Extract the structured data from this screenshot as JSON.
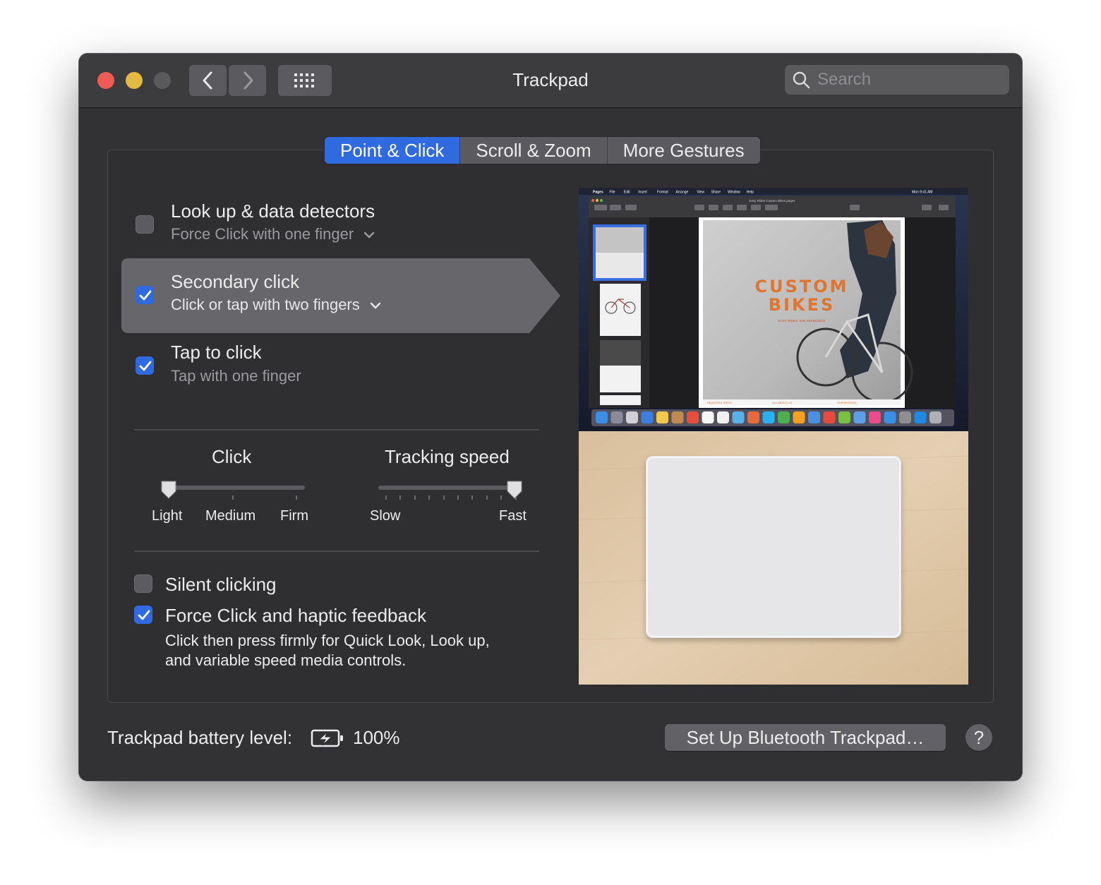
{
  "window": {
    "title": "Trackpad",
    "search_placeholder": "Search"
  },
  "tabs": [
    {
      "label": "Point & Click",
      "active": true
    },
    {
      "label": "Scroll & Zoom",
      "active": false
    },
    {
      "label": "More Gestures",
      "active": false
    }
  ],
  "options": [
    {
      "title": "Look up & data detectors",
      "subtitle": "Force Click with one finger",
      "checked": false,
      "has_dropdown": true
    },
    {
      "title": "Secondary click",
      "subtitle": "Click or tap with two fingers",
      "checked": true,
      "has_dropdown": true,
      "selected": true
    },
    {
      "title": "Tap to click",
      "subtitle": "Tap with one finger",
      "checked": true,
      "has_dropdown": false
    }
  ],
  "sliders": {
    "click": {
      "title": "Click",
      "labels": [
        "Light",
        "Medium",
        "Firm"
      ],
      "value": "Light"
    },
    "tracking": {
      "title": "Tracking speed",
      "min_label": "Slow",
      "max_label": "Fast",
      "level": 1.0
    }
  },
  "silent_clicking": {
    "label": "Silent clicking",
    "checked": false
  },
  "force_click": {
    "label": "Force Click and haptic feedback",
    "checked": true,
    "description_line1": "Click then press firmly for Quick Look, Look up,",
    "description_line2": "and variable speed media controls."
  },
  "preview": {
    "menu_items": [
      "Pages",
      "File",
      "Edit",
      "Insert",
      "Format",
      "Arrange",
      "View",
      "Share",
      "Window",
      "Help"
    ],
    "clock": "Mon 9:41 AM",
    "doc_title": "Easy Rides Custom Bikes.pages",
    "doc_headline_1": "CUSTOM",
    "doc_headline_2": "BIKES",
    "doc_tagline": "EASY RIDES, SAN FRANCISCO",
    "footer_labels": [
      "BEAUTIFUL BIKES",
      "ALL ABOUT US",
      "OUR MISSION"
    ]
  },
  "footer": {
    "battery_label": "Trackpad battery level:",
    "battery_value": "100%",
    "setup_button": "Set Up Bluetooth Trackpad…",
    "help_button": "?"
  },
  "colors": {
    "accent": "#2f6ae0",
    "window_bg": "#323235",
    "close": "#ee5c55",
    "minimize": "#e2b941",
    "zoom_disabled": "#5a5a5d",
    "headline_orange": "#e07530"
  }
}
